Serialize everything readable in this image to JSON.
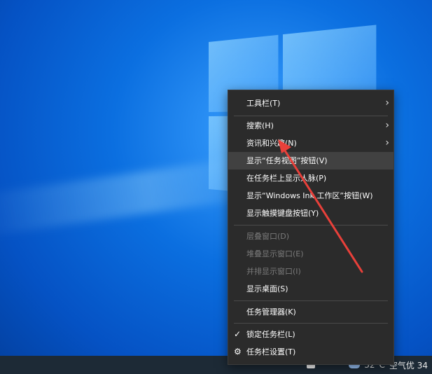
{
  "menu": {
    "items": [
      {
        "label": "工具栏(T)",
        "has_submenu": true,
        "disabled": false
      },
      {
        "label": "搜索(H)",
        "has_submenu": true,
        "disabled": false
      },
      {
        "label": "资讯和兴趣(N)",
        "has_submenu": true,
        "disabled": false
      },
      {
        "label": "显示“任务视图”按钮(V)",
        "has_submenu": false,
        "disabled": false,
        "highlighted": true
      },
      {
        "label": "在任务栏上显示人脉(P)",
        "has_submenu": false,
        "disabled": false
      },
      {
        "label": "显示“Windows Ink 工作区”按钮(W)",
        "has_submenu": false,
        "disabled": false
      },
      {
        "label": "显示触摸键盘按钮(Y)",
        "has_submenu": false,
        "disabled": false
      },
      {
        "label": "层叠窗口(D)",
        "has_submenu": false,
        "disabled": true
      },
      {
        "label": "堆叠显示窗口(E)",
        "has_submenu": false,
        "disabled": true
      },
      {
        "label": "并排显示窗口(I)",
        "has_submenu": false,
        "disabled": true
      },
      {
        "label": "显示桌面(S)",
        "has_submenu": false,
        "disabled": false
      },
      {
        "label": "任务管理器(K)",
        "has_submenu": false,
        "disabled": false
      },
      {
        "label": "锁定任务栏(L)",
        "has_submenu": false,
        "disabled": false,
        "checked": true
      },
      {
        "label": "任务栏设置(T)",
        "has_submenu": false,
        "disabled": false,
        "icon": "gear-icon"
      }
    ]
  },
  "taskbar": {
    "weather_temp": "32°C",
    "air_quality": "空气优 34"
  },
  "icons": {
    "submenu": "chevron-right-icon",
    "check": "check-icon",
    "settings": "gear-icon"
  },
  "colors": {
    "menu_bg": "#2b2b2b",
    "menu_hover": "#414141",
    "annotation_arrow": "#e8403a",
    "taskbar": "#1d2a36"
  }
}
